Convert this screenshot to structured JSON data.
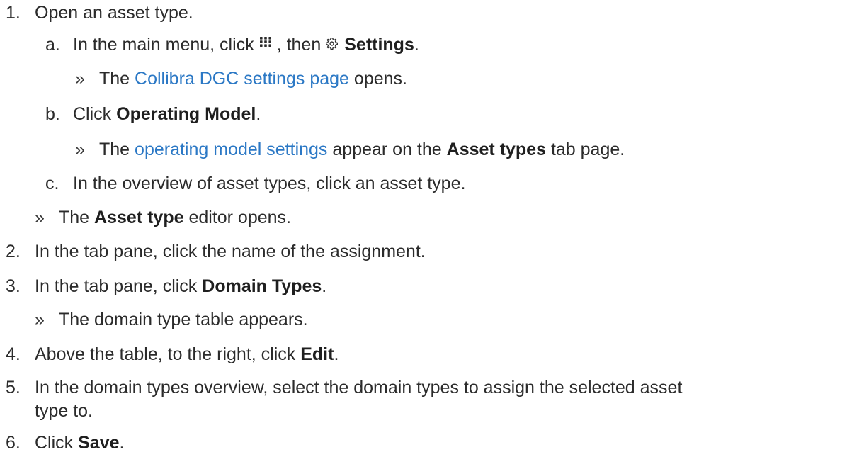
{
  "steps": {
    "s1": {
      "num": "1.",
      "text": "Open an asset type."
    },
    "s1a": {
      "num": "a.",
      "pre": "In the main menu, click",
      "mid": ", then",
      "bold": "Settings",
      "post": ".",
      "apps_icon": "apps-grid-icon",
      "gear_icon": "gear-icon"
    },
    "s1a_result": {
      "marker": "»",
      "pre": "The",
      "link": "Collibra DGC settings page",
      "post": "opens."
    },
    "s1b": {
      "num": "b.",
      "pre": "Click",
      "bold": "Operating Model",
      "post": "."
    },
    "s1b_result": {
      "marker": "»",
      "pre": "The",
      "link": "operating model settings",
      "mid": "appear on the",
      "bold": "Asset types",
      "post": "tab page."
    },
    "s1c": {
      "num": "c.",
      "text": "In the overview of asset types, click an asset type."
    },
    "s1_result": {
      "marker": "»",
      "pre": "The",
      "bold": "Asset type",
      "post": "editor opens."
    },
    "s2": {
      "num": "2.",
      "text": "In the tab pane, click the name of the assignment."
    },
    "s3": {
      "num": "3.",
      "pre": "In the tab pane, click",
      "bold": "Domain Types",
      "post": "."
    },
    "s3_result": {
      "marker": "»",
      "text": "The domain type table appears."
    },
    "s4": {
      "num": "4.",
      "pre": "Above the table, to the right, click",
      "bold": "Edit",
      "post": "."
    },
    "s5": {
      "num": "5.",
      "line1": "In the domain types overview, select the domain types to assign the selected asset",
      "line2": "type to."
    },
    "s6": {
      "num": "6.",
      "pre": "Click",
      "bold": "Save",
      "post": "."
    }
  },
  "colors": {
    "text": "#2b2b2b",
    "link": "#2b78c5"
  }
}
